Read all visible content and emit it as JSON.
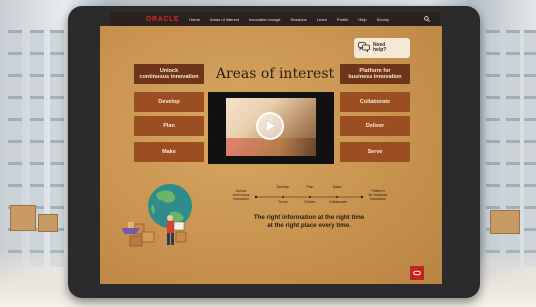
{
  "nav": {
    "logo": "ORACLE",
    "items": [
      "Home",
      "Areas of interest",
      "Innovation lounge",
      "Sessions",
      "Learn",
      "Profile",
      "Help",
      "Survey"
    ]
  },
  "help": {
    "label_line1": "Need",
    "label_line2": "help?"
  },
  "page": {
    "title": "Areas of interest",
    "tagline_line1": "The right information at the right time",
    "tagline_line2": "at the right place every time."
  },
  "left_buttons": {
    "head_line1": "Unlock",
    "head_line2": "continuous innovation",
    "develop": "Develop",
    "plan": "Plan",
    "make": "Make"
  },
  "right_buttons": {
    "head_line1": "Platform for",
    "head_line2": "business innovation",
    "collaborate": "Collaborate",
    "deliver": "Deliver",
    "serve": "Serve"
  },
  "timeline": {
    "start_line1": "Unlock",
    "start_line2": "continuous",
    "start_line3": "innovation",
    "end_line1": "Platform",
    "end_line2": "for business",
    "end_line3": "innovation",
    "top": [
      "Develop",
      "Plan",
      "Make"
    ],
    "bottom": [
      "Serve",
      "Deliver",
      "Collaborate"
    ]
  },
  "colors": {
    "brand_red": "#e2231a",
    "button_brown": "#9c4e23",
    "header_brown": "#6e3519"
  },
  "icons": {
    "help": "chat-bubbles-icon",
    "play": "play-icon",
    "search": "search-icon",
    "badge": "oracle-o-icon"
  }
}
